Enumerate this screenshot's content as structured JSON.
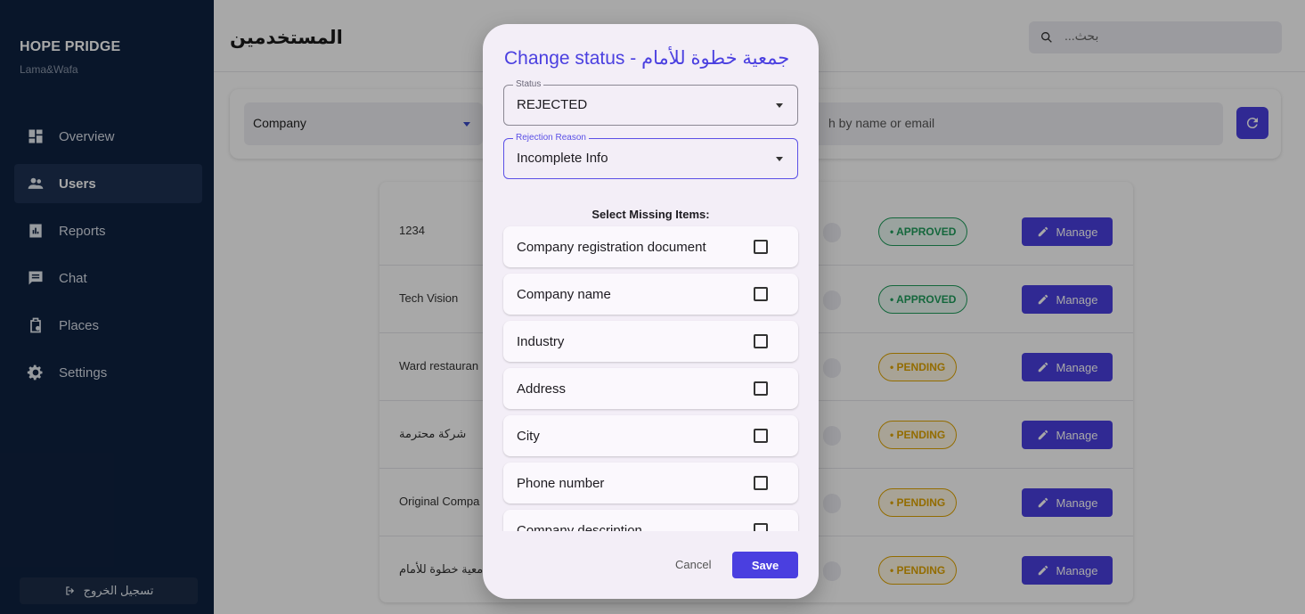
{
  "app": {
    "name": "HOPE PRIDGE",
    "subtitle": "Lama&Wafa"
  },
  "sidebar": {
    "items": [
      {
        "label": "Overview",
        "icon": "dashboard-icon"
      },
      {
        "label": "Users",
        "icon": "users-icon"
      },
      {
        "label": "Reports",
        "icon": "reports-icon"
      },
      {
        "label": "Chat",
        "icon": "chat-icon"
      },
      {
        "label": "Places",
        "icon": "places-icon"
      },
      {
        "label": "Settings",
        "icon": "gear-icon"
      }
    ],
    "active": "Users",
    "logout_label": "تسجيل الخروج"
  },
  "header": {
    "title": "المستخدمين",
    "search_placeholder": "...بحث"
  },
  "filters": {
    "type_value": "Company",
    "search_placeholder": "h by name or email"
  },
  "table": {
    "rows": [
      {
        "name": "1234",
        "status": "• APPROVED",
        "action": "Manage"
      },
      {
        "name": "Tech Vision",
        "status": "• APPROVED",
        "action": "Manage"
      },
      {
        "name": "Ward restauran",
        "status": "• PENDING",
        "action": "Manage"
      },
      {
        "name": "شركة محترمة",
        "status": "• PENDING",
        "action": "Manage"
      },
      {
        "name": "Original Compa",
        "status": "• PENDING",
        "action": "Manage"
      },
      {
        "name": "معية خطوة للأمام",
        "status": "• PENDING",
        "action": "Manage"
      }
    ]
  },
  "dialog": {
    "title": "Change status - جمعية خطوة للأمام",
    "status_label": "Status",
    "status_value": "REJECTED",
    "reason_label": "Rejection Reason",
    "reason_value": "Incomplete Info",
    "missing_title": "Select Missing Items:",
    "missing_items": [
      "Company registration document",
      "Company name",
      "Industry",
      "Address",
      "City",
      "Phone number",
      "Company description"
    ],
    "cancel_label": "Cancel",
    "save_label": "Save"
  },
  "colors": {
    "sidebar_bg": "#0f2240",
    "accent": "#4a3fe0",
    "approved": "#1f9d5c",
    "pending": "#e0a400",
    "dialog_bg": "#f3eef7"
  }
}
